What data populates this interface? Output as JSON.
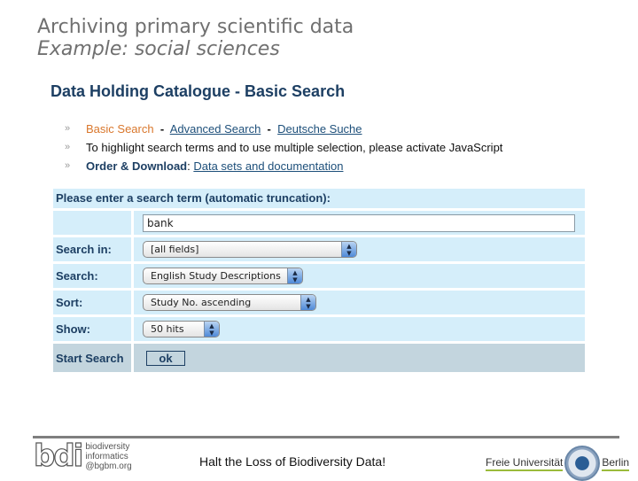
{
  "slide": {
    "title": "Archiving primary scientific data",
    "subtitle": "Example: social sciences"
  },
  "page": {
    "heading": "Data Holding Catalogue - Basic Search",
    "nav": {
      "basic_search": "Basic Search",
      "sep1": " - ",
      "advanced_search": "Advanced Search",
      "sep2": " - ",
      "deutsche_suche": "Deutsche Suche"
    },
    "notice": "To highlight search terms and to use multiple selection, please activate JavaScript",
    "order": {
      "label": "Order & Download",
      "colon": ": ",
      "link": "Data sets and documentation"
    }
  },
  "form": {
    "header": "Please enter a search term (automatic truncation):",
    "search_term": "bank",
    "rows": [
      {
        "label": "Search in:",
        "value": "[all fields]"
      },
      {
        "label": "Search:",
        "value": "English Study Descriptions"
      },
      {
        "label": "Sort:",
        "value": "Study No. ascending"
      },
      {
        "label": "Show:",
        "value": "50 hits"
      }
    ],
    "start_label": "Start Search",
    "ok_label": "ok"
  },
  "footer": {
    "slogan": "Halt the Loss of Biodiversity Data!",
    "bdi_mark": "bdi",
    "bdi_lines": [
      "biodiversity",
      "informatics",
      "@bgbm.org"
    ],
    "fu_left": "Freie Universität",
    "fu_right": "Berlin"
  },
  "colors": {
    "heading": "#1d3f63",
    "active_nav": "#d9772c",
    "row_bg": "#d5eefa",
    "submit_row_bg": "#c3d5de"
  }
}
